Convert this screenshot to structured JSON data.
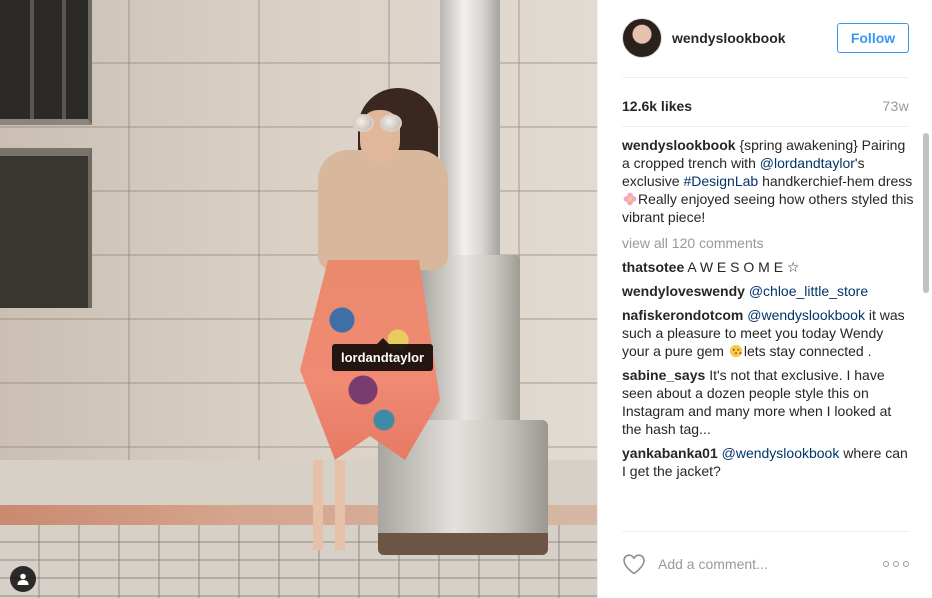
{
  "post": {
    "tag_label": "lordandtaylor"
  },
  "header": {
    "username": "wendyslookbook",
    "follow_label": "Follow"
  },
  "stats": {
    "likes": "12.6k likes",
    "age": "73w"
  },
  "caption": {
    "user": "wendyslookbook",
    "text_1": "{spring awakening} Pairing a cropped trench with ",
    "mention": "@lordandtaylor",
    "text_2": "'s exclusive ",
    "hashtag": "#DesignLab",
    "text_3": " handkerchief-hem dress ",
    "text_4": "Really enjoyed seeing how others styled this vibrant piece!"
  },
  "view_all": "view all 120 comments",
  "comments": [
    {
      "user": "thatsotee",
      "text": "A W E S O M E ☆",
      "mention": "",
      "text_after": ""
    },
    {
      "user": "wendyloveswendy",
      "text": "",
      "mention": "@chloe_little_store",
      "text_after": ""
    },
    {
      "user": "nafiskerondotcom",
      "text": "",
      "mention": "@wendyslookbook",
      "text_after": " it was such a pleasure to meet you today Wendy your a pure gem ",
      "text_end": "lets stay connected ."
    },
    {
      "user": "sabine_says",
      "text": "It's not that exclusive. I have seen about a dozen people style this on Instagram and many more when I looked at the hash tag...",
      "mention": "",
      "text_after": ""
    },
    {
      "user": "yankabanka01",
      "text": "",
      "mention": "@wendyslookbook",
      "text_after": " where can I get the jacket?"
    }
  ],
  "footer": {
    "add_comment_placeholder": "Add a comment..."
  },
  "icons": {
    "heart": "heart-icon",
    "more": "more-options-icon",
    "user_tag": "user-tag-icon"
  },
  "colors": {
    "accent": "#3897f0",
    "link": "#003569",
    "muted": "#999999"
  }
}
